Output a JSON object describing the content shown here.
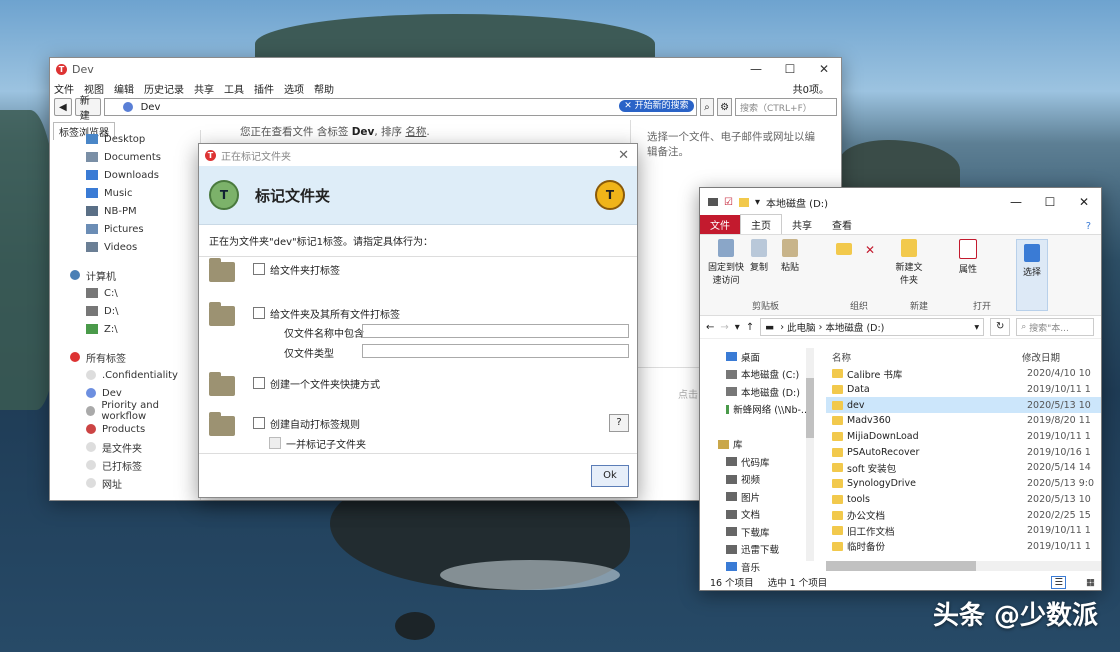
{
  "tagspaces": {
    "title": "Dev",
    "menu": [
      "文件",
      "视图",
      "编辑",
      "历史记录",
      "共享",
      "工具",
      "插件",
      "选项",
      "帮助"
    ],
    "menu_right": "共0项。",
    "back_label": "◀",
    "new_label": "新建",
    "address": "Dev",
    "start_search": "✕ 开始新的搜索",
    "search_placeholder": "搜索（CTRL+F）",
    "tab_label": "标签浏览器",
    "content_head_prefix": "您正在查看文件 含标签 ",
    "content_head_tag": "Dev",
    "content_head_suffix": ", 排序 ",
    "content_head_sort": "名称",
    "content_head_end": ".",
    "right_hint": "选择一个文件、电子邮件或网址以编辑备注。",
    "click_hint": "点击",
    "sidebar": [
      {
        "label": "Desktop",
        "kind": "child",
        "icon": "#4a86c7"
      },
      {
        "label": "Documents",
        "kind": "child",
        "icon": "#7a8fa6"
      },
      {
        "label": "Downloads",
        "kind": "child",
        "icon": "#3a7bd5"
      },
      {
        "label": "Music",
        "kind": "child",
        "icon": "#3a7bd5"
      },
      {
        "label": "NB-PM",
        "kind": "child",
        "icon": "#5a6f86"
      },
      {
        "label": "Pictures",
        "kind": "child",
        "icon": "#6b8db5"
      },
      {
        "label": "Videos",
        "kind": "child",
        "icon": "#6b7f95"
      },
      {
        "label": "",
        "kind": "spacer",
        "icon": ""
      },
      {
        "label": "计算机",
        "kind": "group",
        "icon": "#4a7fb5"
      },
      {
        "label": "C:\\",
        "kind": "child",
        "icon": "#777"
      },
      {
        "label": "D:\\",
        "kind": "child",
        "icon": "#777"
      },
      {
        "label": "Z:\\",
        "kind": "child",
        "icon": "#4a9a4a"
      },
      {
        "label": "",
        "kind": "spacer",
        "icon": ""
      },
      {
        "label": "所有标签",
        "kind": "group",
        "icon": "#d33"
      },
      {
        "label": ".Confidentiality",
        "kind": "child",
        "icon": "#ddd"
      },
      {
        "label": "Dev",
        "kind": "child",
        "icon": "#6d8fe0"
      },
      {
        "label": "Priority and workflow",
        "kind": "child",
        "icon": "#aaa"
      },
      {
        "label": "Products",
        "kind": "child",
        "icon": "#c44"
      },
      {
        "label": "是文件夹",
        "kind": "child",
        "icon": "#ddd"
      },
      {
        "label": "已打标签",
        "kind": "child",
        "icon": "#ddd"
      },
      {
        "label": "网址",
        "kind": "child",
        "icon": "#ddd"
      }
    ]
  },
  "dialog": {
    "title": "正在标记文件夹",
    "heading": "标记文件夹",
    "subtitle": "正在为文件夹\"dev\"标记1标签。请指定具体行为：",
    "opt1": "给文件夹打标签",
    "opt2": "给文件夹及其所有文件打标签",
    "opt2_name_label": "仅文件名称中包含",
    "opt2_type_label": "仅文件类型",
    "opt3": "创建一个文件夹快捷方式",
    "opt4": "创建自动打标签规则",
    "opt4_sub": "一并标记子文件夹",
    "help": "?",
    "ok": "Ok"
  },
  "explorer": {
    "title": "本地磁盘 (D:)",
    "tabs": {
      "file": "文件",
      "home": "主页",
      "share": "共享",
      "view": "查看"
    },
    "ribbon": {
      "pin": "固定到快速访问",
      "copy": "复制",
      "paste": "粘贴",
      "new_folder": "新建文件夹",
      "properties": "属性",
      "select": "选择",
      "group_clipboard": "剪贴板",
      "group_organize": "组织",
      "group_new": "新建",
      "group_open": "打开"
    },
    "breadcrumb": [
      "此电脑",
      "本地磁盘 (D:)"
    ],
    "search_placeholder": "搜索\"本...",
    "nav": [
      {
        "label": "桌面",
        "icon": "#3a7bd5",
        "indent": 1
      },
      {
        "label": "本地磁盘 (C:)",
        "icon": "#777",
        "indent": 1
      },
      {
        "label": "本地磁盘 (D:)",
        "icon": "#777",
        "indent": 1
      },
      {
        "label": "新蜂网络 (\\\\Nb-...",
        "icon": "#4a9a4a",
        "indent": 1
      },
      {
        "label": "",
        "icon": "",
        "indent": 0
      },
      {
        "label": "库",
        "icon": "#c9a74a",
        "indent": 0
      },
      {
        "label": "代码库",
        "icon": "#666",
        "indent": 1
      },
      {
        "label": "视频",
        "icon": "#666",
        "indent": 1
      },
      {
        "label": "图片",
        "icon": "#666",
        "indent": 1
      },
      {
        "label": "文档",
        "icon": "#666",
        "indent": 1
      },
      {
        "label": "下载库",
        "icon": "#666",
        "indent": 1
      },
      {
        "label": "迅雷下载",
        "icon": "#666",
        "indent": 1
      },
      {
        "label": "音乐",
        "icon": "#3a7bd5",
        "indent": 1
      }
    ],
    "columns": {
      "name": "名称",
      "date": "修改日期"
    },
    "files": [
      {
        "name": "Calibre 书库",
        "date": "2020/4/10 10"
      },
      {
        "name": "Data",
        "date": "2019/10/11 1"
      },
      {
        "name": "dev",
        "date": "2020/5/13 10",
        "selected": true
      },
      {
        "name": "Madv360",
        "date": "2019/8/20 11"
      },
      {
        "name": "MijiaDownLoad",
        "date": "2019/10/11 1"
      },
      {
        "name": "PSAutoRecover",
        "date": "2019/10/16 1"
      },
      {
        "name": "soft 安装包",
        "date": "2020/5/14 14"
      },
      {
        "name": "SynologyDrive",
        "date": "2020/5/13 9:0"
      },
      {
        "name": "tools",
        "date": "2020/5/13 10"
      },
      {
        "name": "办公文档",
        "date": "2020/2/25 15"
      },
      {
        "name": "旧工作文档",
        "date": "2019/10/11 1"
      },
      {
        "name": "临时备份",
        "date": "2019/10/11 1"
      }
    ],
    "status_count": "16 个项目",
    "status_selected": "选中 1 个项目"
  },
  "watermark": "头条 @少数派"
}
